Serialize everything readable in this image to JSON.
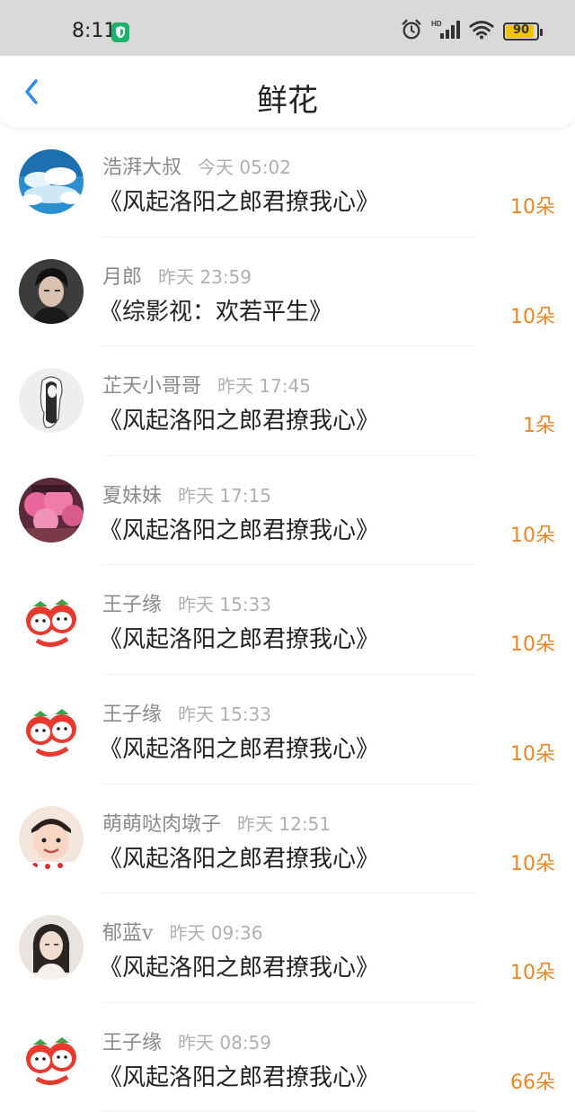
{
  "status_bar": {
    "time": "8:11",
    "battery": "90",
    "battery_level": 0.9,
    "icons": [
      "shield-icon",
      "alarm-icon",
      "hd-signal-icon",
      "wifi-icon",
      "battery-icon"
    ]
  },
  "header": {
    "title": "鲜花",
    "back_icon": "chevron-left-icon"
  },
  "colors": {
    "accent": "#e8862a",
    "back_arrow": "#2d8cf0",
    "status_bar_bg": "#d9d9d9"
  },
  "items": [
    {
      "name": "浩湃大叔",
      "time": "今天 05:02",
      "book": "《风起洛阳之郎君撩我心》",
      "count": "10朵",
      "avatar": "sky-clouds"
    },
    {
      "name": "月郎",
      "time": "昨天 23:59",
      "book": "《综影视：欢若平生》",
      "count": "10朵",
      "avatar": "man-portrait"
    },
    {
      "name": "芷天小哥哥",
      "time": "昨天 17:45",
      "book": "《风起洛阳之郎君撩我心》",
      "count": "1朵",
      "avatar": "sketch-figure"
    },
    {
      "name": "夏妹妹",
      "time": "昨天 17:15",
      "book": "《风起洛阳之郎君撩我心》",
      "count": "10朵",
      "avatar": "pink-blossoms"
    },
    {
      "name": "王子缘",
      "time": "昨天 15:33",
      "book": "《风起洛阳之郎君撩我心》",
      "count": "10朵",
      "avatar": "strawberry-characters"
    },
    {
      "name": "王子缘",
      "time": "昨天 15:33",
      "book": "《风起洛阳之郎君撩我心》",
      "count": "10朵",
      "avatar": "strawberry-characters"
    },
    {
      "name": "萌萌哒肉墩子",
      "time": "昨天 12:51",
      "book": "《风起洛阳之郎君撩我心》",
      "count": "10朵",
      "avatar": "child-photo"
    },
    {
      "name": "郁蓝v",
      "time": "昨天 09:36",
      "book": "《风起洛阳之郎君撩我心》",
      "count": "10朵",
      "avatar": "woman-portrait"
    },
    {
      "name": "王子缘",
      "time": "昨天 08:59",
      "book": "《风起洛阳之郎君撩我心》",
      "count": "66朵",
      "avatar": "strawberry-characters"
    }
  ]
}
